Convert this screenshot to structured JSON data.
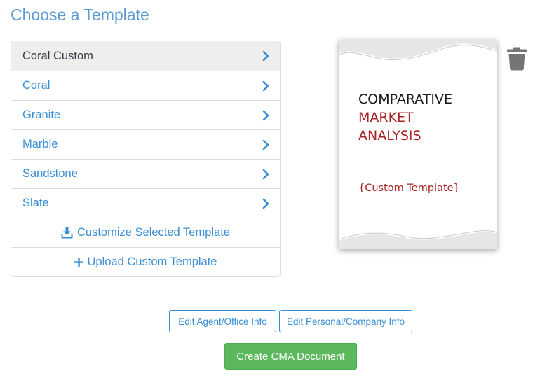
{
  "page": {
    "title": "Choose a Template"
  },
  "templates": [
    {
      "label": "Coral Custom",
      "selected": true
    },
    {
      "label": "Coral",
      "selected": false
    },
    {
      "label": "Granite",
      "selected": false
    },
    {
      "label": "Marble",
      "selected": false
    },
    {
      "label": "Sandstone",
      "selected": false
    },
    {
      "label": "Slate",
      "selected": false
    }
  ],
  "actions": {
    "customize_label": "Customize Selected Template",
    "customize_icon": "download-icon",
    "upload_label": "Upload Custom Template",
    "upload_icon": "plus-icon"
  },
  "preview": {
    "line1": "COMPARATIVE",
    "line2": "MARKET",
    "line3": "ANALYSIS",
    "custom_label": "{Custom Template}",
    "delete_icon": "trash-icon"
  },
  "buttons": {
    "edit_agent": "Edit Agent/Office Info",
    "edit_personal": "Edit Personal/Company Info",
    "create": "Create CMA Document"
  },
  "colors": {
    "title": "#5b9bd5",
    "link": "#3a8ed4",
    "selected_row_bg": "#eeeeee",
    "accent_red": "#a82323",
    "primary_button": "#5cb85c",
    "trash": "#757575"
  }
}
